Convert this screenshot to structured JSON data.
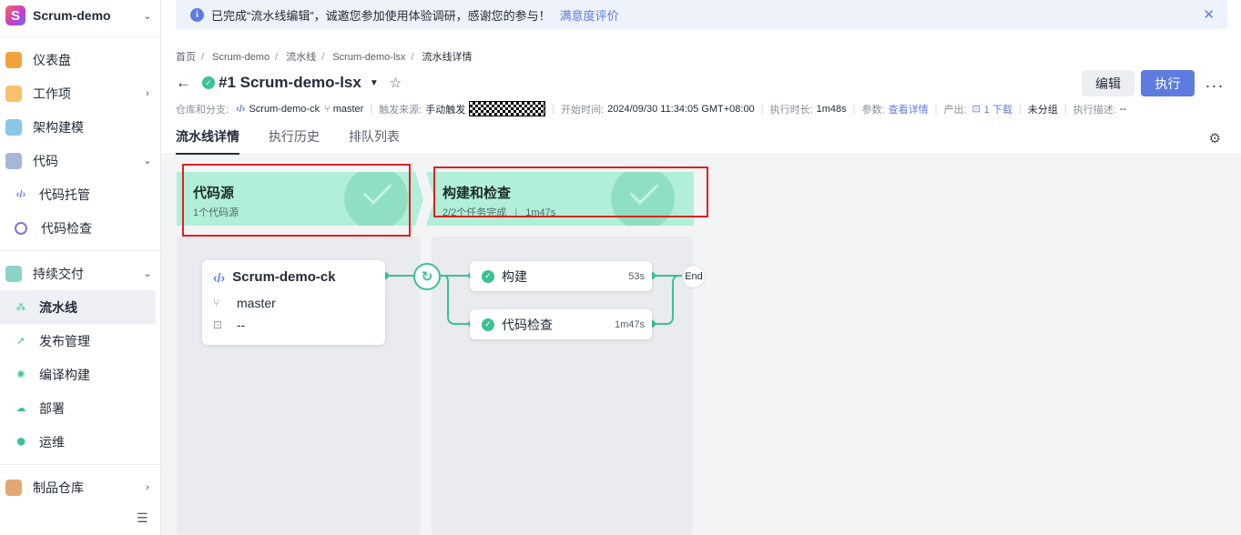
{
  "project": {
    "logo": "S",
    "name": "Scrum-demo"
  },
  "sidebar": {
    "items": [
      {
        "label": "仪表盘",
        "icon": "dashboard-icon",
        "color": "#f2a33a"
      },
      {
        "label": "工作项",
        "icon": "workitem-icon",
        "color": "#f7c26b"
      },
      {
        "label": "架构建模",
        "icon": "architecture-icon",
        "color": "#8ac6e6"
      },
      {
        "label": "代码",
        "icon": "code-icon",
        "color": "#a5b6d8"
      },
      {
        "label": "代码托管",
        "icon": "code-hosting-icon",
        "color": "#5e7ce0"
      },
      {
        "label": "代码检查",
        "icon": "code-check-icon",
        "color": "#8b6fd6"
      },
      {
        "label": "持续交付",
        "icon": "delivery-icon",
        "color": "#8ad3c8"
      },
      {
        "label": "流水线",
        "icon": "pipeline-icon",
        "color": "#3ac295"
      },
      {
        "label": "发布管理",
        "icon": "release-icon",
        "color": "#3ac295"
      },
      {
        "label": "编译构建",
        "icon": "build-icon",
        "color": "#3ac295"
      },
      {
        "label": "部署",
        "icon": "deploy-icon",
        "color": "#3ac295"
      },
      {
        "label": "运维",
        "icon": "ops-icon",
        "color": "#3ac295"
      },
      {
        "label": "制品仓库",
        "icon": "artifact-icon",
        "color": "#e0a870"
      }
    ]
  },
  "banner": {
    "text": "已完成“流水线编辑”，诚邀您参加使用体验调研，感谢您的参与！",
    "link": "满意度评价",
    "close": "✕"
  },
  "breadcrumb": [
    "首页",
    "Scrum-demo",
    "流水线",
    "Scrum-demo-lsx",
    "流水线详情"
  ],
  "header": {
    "title": "#1 Scrum-demo-lsx",
    "edit_label": "编辑",
    "run_label": "执行",
    "more_label": "···"
  },
  "meta": {
    "repo_key": "仓库和分支:",
    "repo": "Scrum-demo-ck",
    "branch": "master",
    "trigger_key": "触发来源:",
    "trigger": "手动触发",
    "start_key": "开始时间:",
    "start": "2024/09/30 11:34:05 GMT+08:00",
    "duration_key": "执行时长:",
    "duration": "1m48s",
    "params_key": "参数:",
    "params_link": "查看详情",
    "output_key": "产出:",
    "output_link": "1 下载",
    "group": "未分组",
    "desc_key": "执行描述:",
    "desc": "--"
  },
  "tabs": [
    "流水线详情",
    "执行历史",
    "排队列表"
  ],
  "stages": [
    {
      "title": "代码源",
      "sub": "1个代码源"
    },
    {
      "title": "构建和检查",
      "sub": "2/2个任务完成",
      "duration": "1m47s"
    }
  ],
  "source_card": {
    "name": "Scrum-demo-ck",
    "branch": "master",
    "extra": "--"
  },
  "jobs": [
    {
      "name": "构建",
      "duration": "53s"
    },
    {
      "name": "代码检查",
      "duration": "1m47s"
    }
  ],
  "end_label": "End",
  "colors": {
    "primary": "#5e7ce0",
    "success": "#3ac295",
    "stage_bg": "#b1efd9",
    "highlight": "#e21f1f"
  }
}
